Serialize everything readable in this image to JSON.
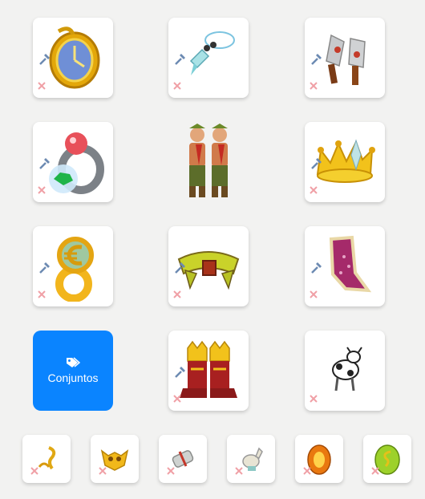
{
  "sets_button": {
    "label": "Conjuntos",
    "icon": "tag-icon",
    "color": "#0a84ff"
  },
  "equipment_slots": [
    {
      "item": "clock-amulet-icon"
    },
    {
      "item": "crystal-pendant-icon"
    },
    {
      "item": "cleaver-weapon-icon"
    },
    {
      "item": "gem-ring-icon"
    },
    {
      "item": "crown-hat-icon"
    },
    {
      "item": "euro-ring-icon"
    },
    {
      "item": "belt-icon"
    },
    {
      "item": "cape-icon"
    },
    {
      "item": "royal-boots-icon"
    },
    {
      "item": "cow-pet-icon"
    }
  ],
  "small_slots": [
    {
      "item": "golden-hook-icon"
    },
    {
      "item": "golden-mask-icon"
    },
    {
      "item": "scroll-bundle-icon"
    },
    {
      "item": "mount-figurine-icon"
    },
    {
      "item": "amber-egg-icon"
    },
    {
      "item": "green-dragon-egg-icon"
    }
  ],
  "character": "character-twins-avatar"
}
